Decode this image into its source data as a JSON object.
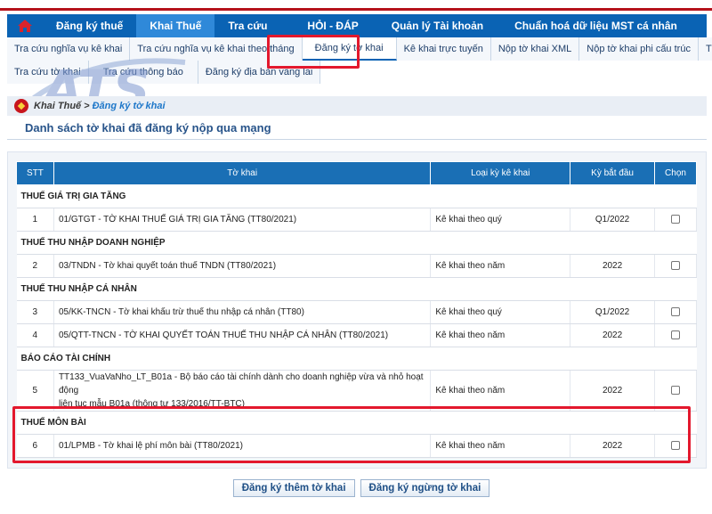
{
  "main_nav": {
    "home_icon": "home-icon",
    "items": [
      {
        "label": "Đăng ký thuế"
      },
      {
        "label": "Khai Thuế"
      },
      {
        "label": "Tra cứu"
      },
      {
        "label": "HỎI - ĐÁP"
      },
      {
        "label": "Quản lý Tài khoản"
      },
      {
        "label": "Chuẩn hoá dữ liệu MST cá nhân"
      }
    ],
    "active_index": 1
  },
  "sub_nav": {
    "row1": [
      "Tra cứu nghĩa vụ kê khai",
      "Tra cứu nghĩa vụ kê khai theo tháng",
      "Đăng ký tờ khai",
      "Kê khai trực tuyến",
      "Nộp tờ khai XML",
      "Nộp tờ khai phi cấu trúc",
      "Trình ký"
    ],
    "row2": [
      "Tra cứu tờ khai",
      "Tra cứu thông báo",
      "Đăng ký địa bàn vãng lai"
    ],
    "selected": "Đăng ký tờ khai"
  },
  "watermark": "ATS",
  "breadcrumb": {
    "parent": "Khai Thuế",
    "separator": ">",
    "current": "Đăng ký tờ khai"
  },
  "page_title": "Danh sách tờ khai đã đăng ký nộp qua mạng",
  "table": {
    "headers": {
      "stt": "STT",
      "form": "Tờ khai",
      "period_type": "Loại kỳ kê khai",
      "start_period": "Kỳ bắt đầu",
      "select": "Chọn"
    },
    "groups": [
      {
        "name": "THUẾ GIÁ TRỊ GIA TĂNG",
        "rows": [
          {
            "stt": "1",
            "form": "01/GTGT - TỜ KHAI THUẾ GIÁ TRỊ GIA TĂNG (TT80/2021)",
            "period_type": "Kê khai theo quý",
            "start": "Q1/2022"
          }
        ]
      },
      {
        "name": "THUẾ THU NHẬP DOANH NGHIỆP",
        "rows": [
          {
            "stt": "2",
            "form": "03/TNDN - Tờ khai quyết toán thuế TNDN (TT80/2021)",
            "period_type": "Kê khai theo năm",
            "start": "2022"
          }
        ]
      },
      {
        "name": "THUẾ THU NHẬP CÁ NHÂN",
        "rows": [
          {
            "stt": "3",
            "form": "05/KK-TNCN - Tờ khai khấu trừ thuế thu nhập cá nhân (TT80)",
            "period_type": "Kê khai theo quý",
            "start": "Q1/2022"
          },
          {
            "stt": "4",
            "form": "05/QTT-TNCN - TỜ KHAI QUYẾT TOÁN THUẾ THU NHẬP CÁ NHÂN (TT80/2021)",
            "period_type": "Kê khai theo năm",
            "start": "2022"
          }
        ]
      },
      {
        "name": "BÁO CÁO TÀI CHÍNH",
        "rows": [
          {
            "stt": "5",
            "form_line1": "TT133_VuaVaNho_LT_B01a - Bộ báo cáo tài chính dành cho doanh nghiệp vừa và nhỏ hoạt động",
            "form_line2": "liên tục mẫu B01a (thông tư 133/2016/TT-BTC)",
            "period_type": "Kê khai theo năm",
            "start": "2022"
          }
        ]
      },
      {
        "name": "THUẾ MÔN BÀI",
        "rows": [
          {
            "stt": "6",
            "form": "01/LPMB - Tờ khai lệ phí môn bài (TT80/2021)",
            "period_type": "Kê khai theo năm",
            "start": "2022"
          }
        ]
      }
    ]
  },
  "buttons": {
    "register_more": "Đăng ký thêm tờ khai",
    "stop_register": "Đăng ký ngừng tờ khai"
  },
  "colors": {
    "nav_blue": "#0a63b4",
    "nav_active": "#2f89d9",
    "highlight_red": "#e3182d",
    "header_blue": "#1a6fb5",
    "brand_red": "#b5121b"
  }
}
